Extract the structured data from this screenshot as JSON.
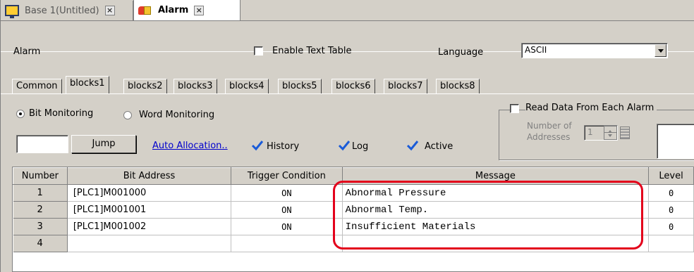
{
  "tabs": {
    "base_label": "Base 1(Untitled)",
    "alarm_label": "Alarm",
    "close_glyph": "×"
  },
  "header": {
    "title": "Alarm",
    "enable_text_table_label": "Enable Text Table",
    "language_label": "Language",
    "language_value": "ASCII"
  },
  "blocks": [
    "Common",
    "blocks1",
    "blocks2",
    "blocks3",
    "blocks4",
    "blocks5",
    "blocks6",
    "blocks7",
    "blocks8"
  ],
  "options": {
    "bit_monitoring_label": "Bit Monitoring",
    "word_monitoring_label": "Word Monitoring",
    "jump_label": "Jump",
    "auto_allocation_label": "Auto Allocation..",
    "history_label": "History",
    "log_label": "Log",
    "active_label": "Active",
    "read_data_label": "Read Data From Each Alarm",
    "number_of_addresses_label_1": "Number of",
    "number_of_addresses_label_2": "Addresses",
    "number_of_addresses_value": "1"
  },
  "table": {
    "headers": [
      "Number",
      "Bit Address",
      "Trigger Condition",
      "Message",
      "Level"
    ],
    "rows": [
      {
        "number": "1",
        "bit_address": "[PLC1]M001000",
        "trigger": "ON",
        "message": "Abnormal Pressure",
        "level": "0"
      },
      {
        "number": "2",
        "bit_address": "[PLC1]M001001",
        "trigger": "ON",
        "message": "Abnormal Temp.",
        "level": "0"
      },
      {
        "number": "3",
        "bit_address": "[PLC1]M001002",
        "trigger": "ON",
        "message": "Insufficient Materials",
        "level": "0"
      },
      {
        "number": "4",
        "bit_address": "",
        "trigger": "",
        "message": "",
        "level": ""
      }
    ]
  },
  "colors": {
    "highlight": "#e3001b",
    "check": "#1a5bd8",
    "link": "#0000cc"
  }
}
